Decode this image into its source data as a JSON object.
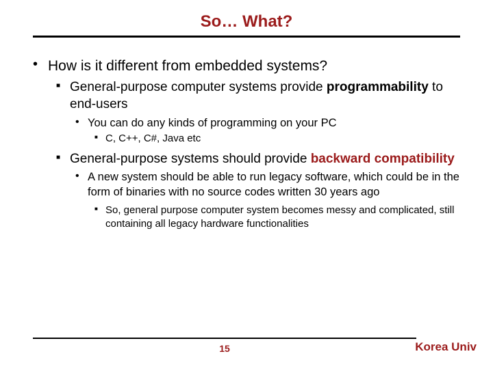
{
  "title": "So… What?",
  "q": "How is it different from embedded systems?",
  "p1a": "General-purpose computer systems provide ",
  "p1b": "programmability",
  "p1c": " to end-users",
  "p1_sub": "You can do any kinds of programming on your PC",
  "p1_sub2": "C, C++, C#, Java etc",
  "p2a": "General-purpose systems should provide ",
  "p2b": "backward compatibility",
  "p2_sub": "A new system should be able to run legacy software, which could be in the form of binaries with no source codes written 30 years ago",
  "p2_sub2": "So, general purpose computer system becomes messy and complicated, still containing all legacy hardware functionalities",
  "page": "15",
  "brand": "Korea Univ"
}
